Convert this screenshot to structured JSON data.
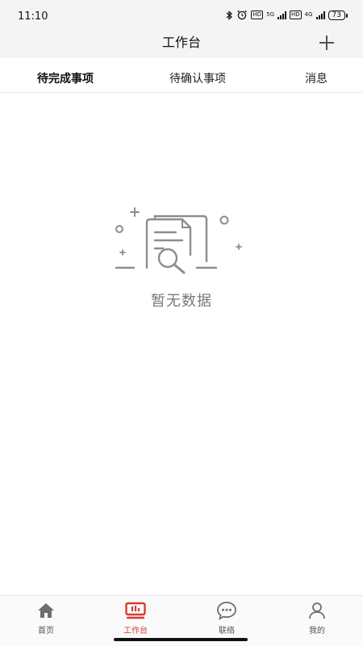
{
  "status_bar": {
    "time": "11:10",
    "network_1": "5G",
    "network_2": "4G",
    "hd_label": "HD",
    "battery": "73"
  },
  "header": {
    "title": "工作台",
    "add_icon": "plus-icon"
  },
  "tabs": [
    {
      "label": "待完成事项",
      "active": true
    },
    {
      "label": "待确认事项",
      "active": false
    },
    {
      "label": "消息",
      "active": false
    }
  ],
  "empty_state": {
    "icon": "empty-document-search-icon",
    "text": "暂无数据"
  },
  "bottom_nav": [
    {
      "label": "首页",
      "icon": "home-icon",
      "active": false
    },
    {
      "label": "工作台",
      "icon": "workbench-icon",
      "active": true
    },
    {
      "label": "联络",
      "icon": "chat-icon",
      "active": false
    },
    {
      "label": "我的",
      "icon": "user-icon",
      "active": false
    }
  ],
  "colors": {
    "accent": "#d83a34",
    "inactive_icon": "#6e6e6e",
    "header_bg": "#f4f4f4"
  }
}
